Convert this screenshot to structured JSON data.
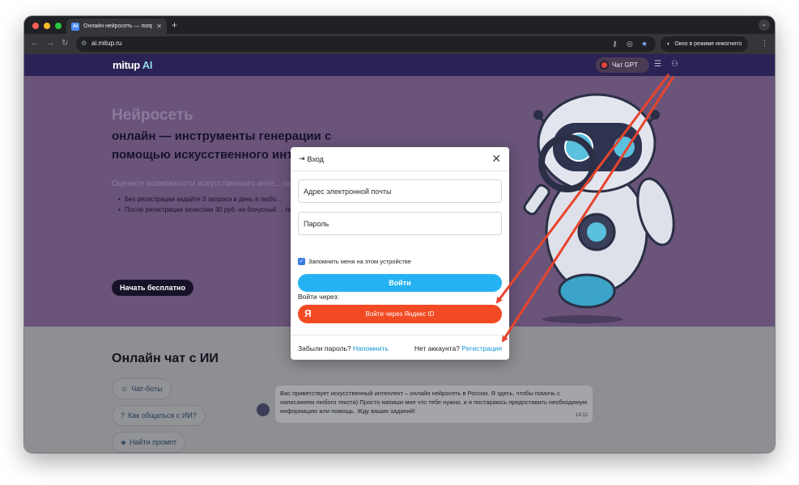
{
  "browser": {
    "tab_title": "Онлайн нейросеть — попроб",
    "tab_favicon": "AI",
    "url": "ai.mitup.ru",
    "incognito_label": "Окно в режиме инкогнито"
  },
  "site": {
    "logo_main": "mitup",
    "logo_accent": "AI",
    "chat_button": "Чат GPT"
  },
  "hero": {
    "title_line1": "Нейросеть",
    "title_line2": "онлайн — инструменты генерации с помощью искусственного интеллекта",
    "subtitle": "Оцените возможности искусственного инте... онлайн бесплатно",
    "bullet1": "Без регистрации задайте 3 запроса в день в любо...",
    "bullet2": "После регистрации зачислим 30 руб. на бонусный ... генерации в чатах",
    "cta": "Начать бесплатно"
  },
  "chat_section": {
    "title": "Онлайн чат с ИИ",
    "chips": [
      "Чат-боты",
      "Как общаться с ИИ?",
      "Найти промпт"
    ],
    "bot_message": "Вас приветствует искусственный интеллект – онлайн нейросеть в России. Я здесь, чтобы помочь с написанием любого текста) Просто напиши мне что тебе нужно, и я постараюсь предоставить необходимую информацию или помощь. Жду ваших заданий!",
    "bot_time": "14:12"
  },
  "modal": {
    "title": "Вход",
    "email_placeholder": "Адрес электронной почты",
    "password_placeholder": "Пароль",
    "remember_label": "Запомнить меня на этом устройстве",
    "login_button": "Войти",
    "via_label": "Войти через:",
    "yandex_button": "Войти через Яндекс ID",
    "yandex_logo": "Я",
    "forgot_text": "Забыли пароль?",
    "remind_link": "Напомнить",
    "no_account_text": "Нет аккаунта?",
    "register_link": "Регистрация"
  },
  "colors": {
    "header_bg": "#2b2255",
    "hero_bg": "#6a547a",
    "login_button": "#25b2f2",
    "yandex_button": "#f24a23",
    "annotation_arrow": "#e8442e"
  }
}
